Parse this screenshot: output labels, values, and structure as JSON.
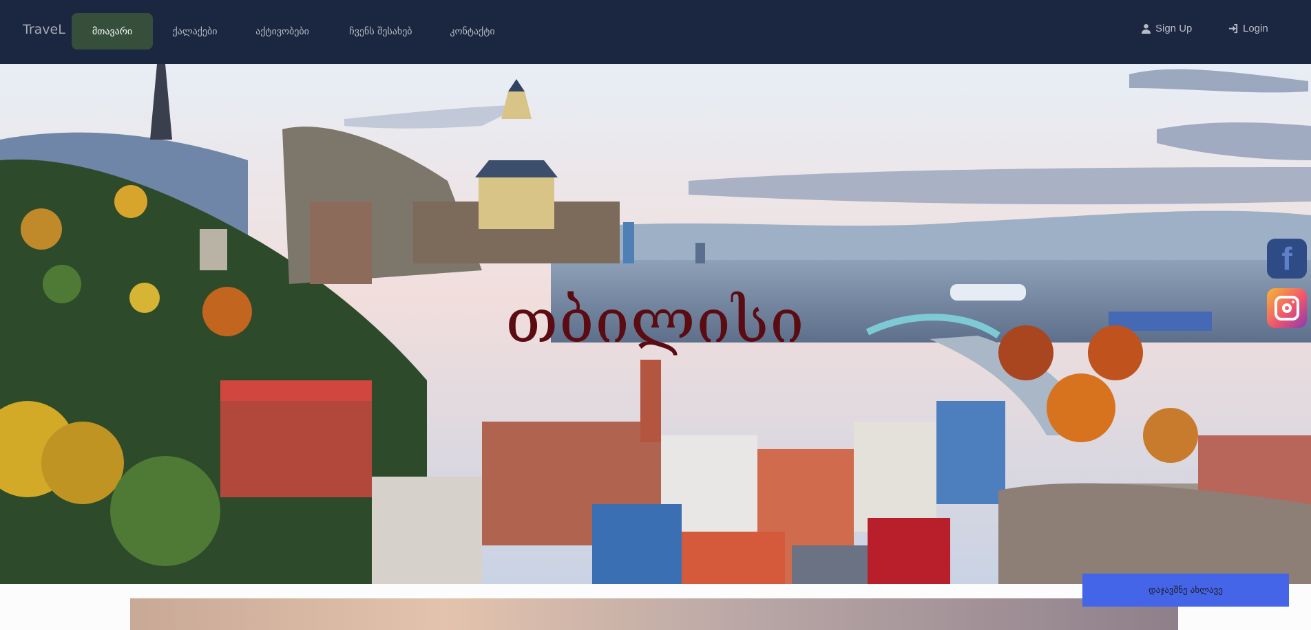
{
  "navbar": {
    "brand": "TraveL",
    "items": [
      {
        "label": "მთავარი",
        "active": true
      },
      {
        "label": "ქალაქები",
        "active": false
      },
      {
        "label": "აქტივობები",
        "active": false
      },
      {
        "label": "ჩვენს შესახებ",
        "active": false
      },
      {
        "label": "კონტაქტი",
        "active": false
      }
    ],
    "signup_label": "Sign Up",
    "login_label": "Login",
    "signup_icon": "user-icon",
    "login_icon": "login-icon"
  },
  "hero": {
    "title": "თბილისი",
    "social": [
      {
        "name": "facebook-icon",
        "glyph": "f"
      },
      {
        "name": "instagram-icon"
      }
    ]
  },
  "back_to_top": {
    "label": "დაჯავშნე ახლავე"
  },
  "colors": {
    "navbar_bg": "#1b2640",
    "active_item_bg": "#354f3b",
    "hero_title": "#5b0b12",
    "button_bg": "#4565e8"
  }
}
